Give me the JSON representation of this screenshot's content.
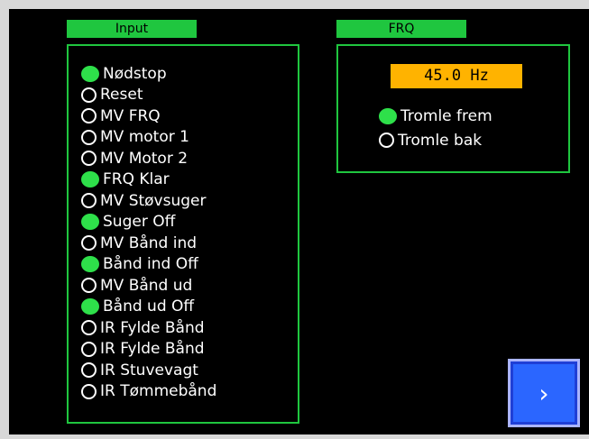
{
  "input": {
    "title": "Input",
    "items": [
      {
        "label": "Nødstop",
        "on": true
      },
      {
        "label": "Reset",
        "on": false
      },
      {
        "label": "MV FRQ",
        "on": false
      },
      {
        "label": "MV motor 1",
        "on": false
      },
      {
        "label": "MV Motor 2",
        "on": false
      },
      {
        "label": "FRQ Klar",
        "on": true
      },
      {
        "label": "MV Støvsuger",
        "on": false
      },
      {
        "label": "Suger Off",
        "on": true
      },
      {
        "label": "MV Bånd ind",
        "on": false
      },
      {
        "label": "Bånd ind Off",
        "on": true
      },
      {
        "label": "MV Bånd ud",
        "on": false
      },
      {
        "label": "Bånd ud Off",
        "on": true
      },
      {
        "label": "IR Fylde Bånd",
        "on": false
      },
      {
        "label": "IR Fylde Bånd",
        "on": false
      },
      {
        "label": "IR Stuvevagt",
        "on": false
      },
      {
        "label": "IR Tømmebånd",
        "on": false
      }
    ]
  },
  "frq": {
    "title": "FRQ",
    "frequency": "45.0 Hz",
    "items": [
      {
        "label": "Tromle frem",
        "on": true
      },
      {
        "label": "Tromle bak",
        "on": false
      }
    ]
  },
  "nav": {
    "next_glyph": "›"
  },
  "colors": {
    "panel_green": "#1fc63f",
    "led_on": "#2ee04a",
    "freq_bg": "#ffb300",
    "button_blue": "#2b66ff"
  }
}
